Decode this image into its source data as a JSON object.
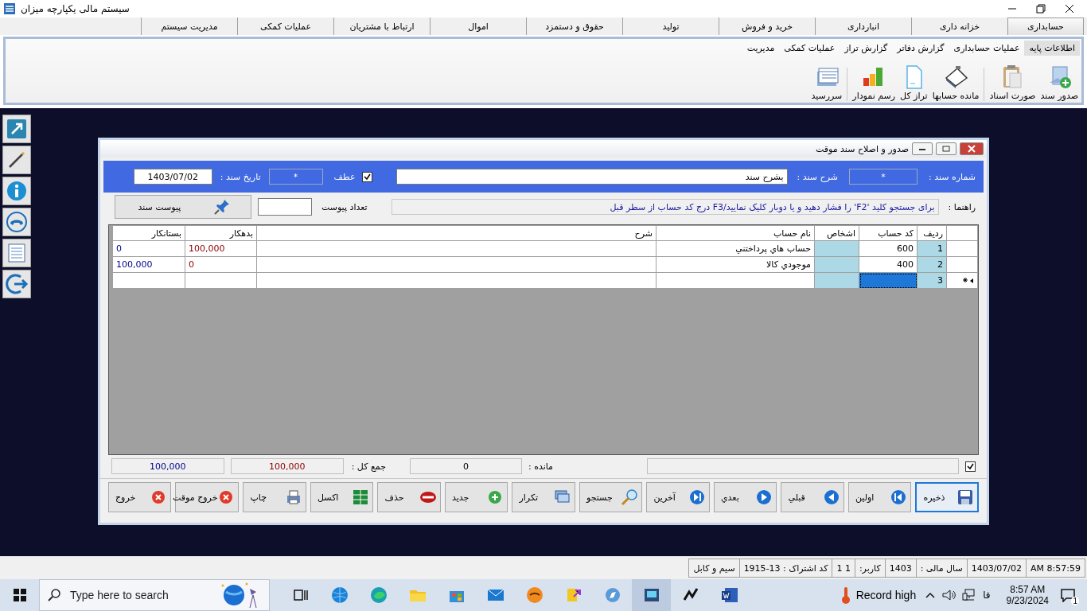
{
  "window": {
    "title": "سیستم مالی یکپارچه میزان"
  },
  "menu_tabs": [
    {
      "label": "حسابداری",
      "selected": true
    },
    {
      "label": "خزانه داری",
      "selected": false
    },
    {
      "label": "انبارداری",
      "selected": false
    },
    {
      "label": "خرید و فروش",
      "selected": false
    },
    {
      "label": "تولید",
      "selected": false
    },
    {
      "label": "حقوق و دستمزد",
      "selected": false
    },
    {
      "label": "اموال",
      "selected": false
    },
    {
      "label": "ارتباط با مشتریان",
      "selected": false
    },
    {
      "label": "عملیات کمکی",
      "selected": false
    },
    {
      "label": "مدیریت سیستم",
      "selected": false
    }
  ],
  "ribbon_tabs": [
    {
      "label": "اطلاعات پایه",
      "selected": true
    },
    {
      "label": "عملیات حسابداری",
      "selected": false
    },
    {
      "label": "گزارش دفاتر",
      "selected": false
    },
    {
      "label": "گزارش تراز",
      "selected": false
    },
    {
      "label": "عملیات کمکی",
      "selected": false
    },
    {
      "label": "مدیریت",
      "selected": false
    }
  ],
  "ribbon_groups": [
    [
      "صدور سند",
      "صورت اسناد"
    ],
    [
      "مانده حسابها",
      "تراز کل",
      "رسم نمودار"
    ],
    [
      "سررسید"
    ]
  ],
  "dialog": {
    "title": "صدور و اصلاح سند موقت",
    "doc_number": {
      "label": "شماره سند :",
      "value": "*"
    },
    "description": {
      "label": "شرح سند :",
      "value": "بشرح سند"
    },
    "reference": {
      "label": "عطف",
      "checked": true,
      "value": "*"
    },
    "date": {
      "label": "تاریخ سند :",
      "value": "1403/07/02"
    },
    "guide": {
      "label": "راهنما :",
      "value": "برای جستجو کلید 'F2' را فشار دهید و یا دوبار کلیک نمایید/F3 درج کد حساب از سطر قبل"
    },
    "attachment_count": {
      "label": "تعداد پیوست"
    },
    "attach_button": "پیوست سند"
  },
  "grid": {
    "columns": [
      "ردیف",
      "کد حساب",
      "اشخاص",
      "نام حساب",
      "شرح",
      "بدهکار",
      "بستانکار"
    ],
    "rows": [
      {
        "row_no": "1",
        "account_code": "600",
        "account_name": "حساب هاي پرداختني",
        "debit": "100,000",
        "credit": "0",
        "new_row": false,
        "selected": false
      },
      {
        "row_no": "2",
        "account_code": "400",
        "account_name": "موجودي كالا",
        "debit": "0",
        "credit": "100,000",
        "new_row": false,
        "selected": false
      },
      {
        "row_no": "3",
        "new_row": true,
        "selected": true
      }
    ]
  },
  "totals": {
    "checked": true,
    "balance_label": "مانده :",
    "balance": "0",
    "total_label": "جمع کل :",
    "total_debit": "100,000",
    "total_credit": "100,000"
  },
  "buttons": [
    {
      "label": "ذخیره",
      "focused": true
    },
    {
      "label": "اولین",
      "focused": false
    },
    {
      "label": "قبلي",
      "focused": false
    },
    {
      "label": "بعدي",
      "focused": false
    },
    {
      "label": "آخرین",
      "focused": false
    },
    {
      "label": "جستجو",
      "focused": false
    },
    {
      "label": "تکرار",
      "focused": false
    },
    {
      "label": "جدید",
      "focused": false
    },
    {
      "label": "حذف",
      "focused": false
    },
    {
      "label": "اکسل",
      "focused": false
    },
    {
      "label": "چاپ",
      "focused": false
    },
    {
      "label": "خروج موقت",
      "focused": false
    },
    {
      "label": "خروج",
      "focused": false
    }
  ],
  "status_bar": [
    "AM 8:57:59",
    "1403/07/02",
    "سال مالی :",
    "1403",
    "کاربر:",
    "1 1",
    "کد اشتراک : 13-1915",
    "سیم و کابل"
  ],
  "taskbar": {
    "search_placeholder": "Type here to search",
    "weather": "Record high",
    "language": "فا",
    "time": "8:57 AM",
    "date": "9/23/2024",
    "notifications": "1"
  }
}
